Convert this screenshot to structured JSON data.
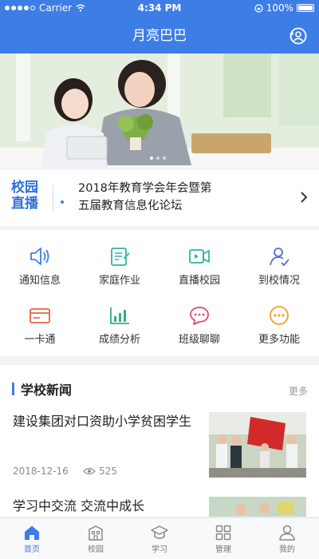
{
  "status_bar": {
    "carrier": "Carrier",
    "time": "4:34 PM",
    "battery": "100%"
  },
  "header": {
    "title": "月亮巴巴"
  },
  "live": {
    "logo_line1": "校园",
    "logo_line2": "直播",
    "line1": "2018年教育学会年会暨第",
    "line2": "五届教育信息化论坛"
  },
  "grid": {
    "items": [
      {
        "label": "通知信息",
        "icon": "speaker-icon"
      },
      {
        "label": "家庭作业",
        "icon": "homework-icon"
      },
      {
        "label": "直播校园",
        "icon": "video-icon"
      },
      {
        "label": "到校情况",
        "icon": "attendance-icon"
      },
      {
        "label": "一卡通",
        "icon": "card-icon"
      },
      {
        "label": "成绩分析",
        "icon": "chart-icon"
      },
      {
        "label": "班级聊聊",
        "icon": "chat-icon"
      },
      {
        "label": "更多功能",
        "icon": "more-icon"
      }
    ],
    "colors": [
      "#3d7ee6",
      "#2bb6a3",
      "#2bb6a3",
      "#5b6bd6",
      "#e8643c",
      "#33b07a",
      "#e24a6a",
      "#f0a020"
    ]
  },
  "news": {
    "title": "学校新闻",
    "more": "更多",
    "articles": [
      {
        "title": "建设集团对口资助小学贫困学生",
        "date": "2018-12-16",
        "views": "525"
      },
      {
        "title": "学习中交流 交流中成长",
        "date": "",
        "views": ""
      }
    ]
  },
  "tabbar": {
    "items": [
      {
        "label": "首页",
        "icon": "home-icon"
      },
      {
        "label": "校园",
        "icon": "school-icon"
      },
      {
        "label": "学习",
        "icon": "graduation-cap-icon"
      },
      {
        "label": "管理",
        "icon": "grid-icon"
      },
      {
        "label": "我的",
        "icon": "user-icon"
      }
    ]
  },
  "colors": {
    "primary": "#3d7ee6"
  }
}
